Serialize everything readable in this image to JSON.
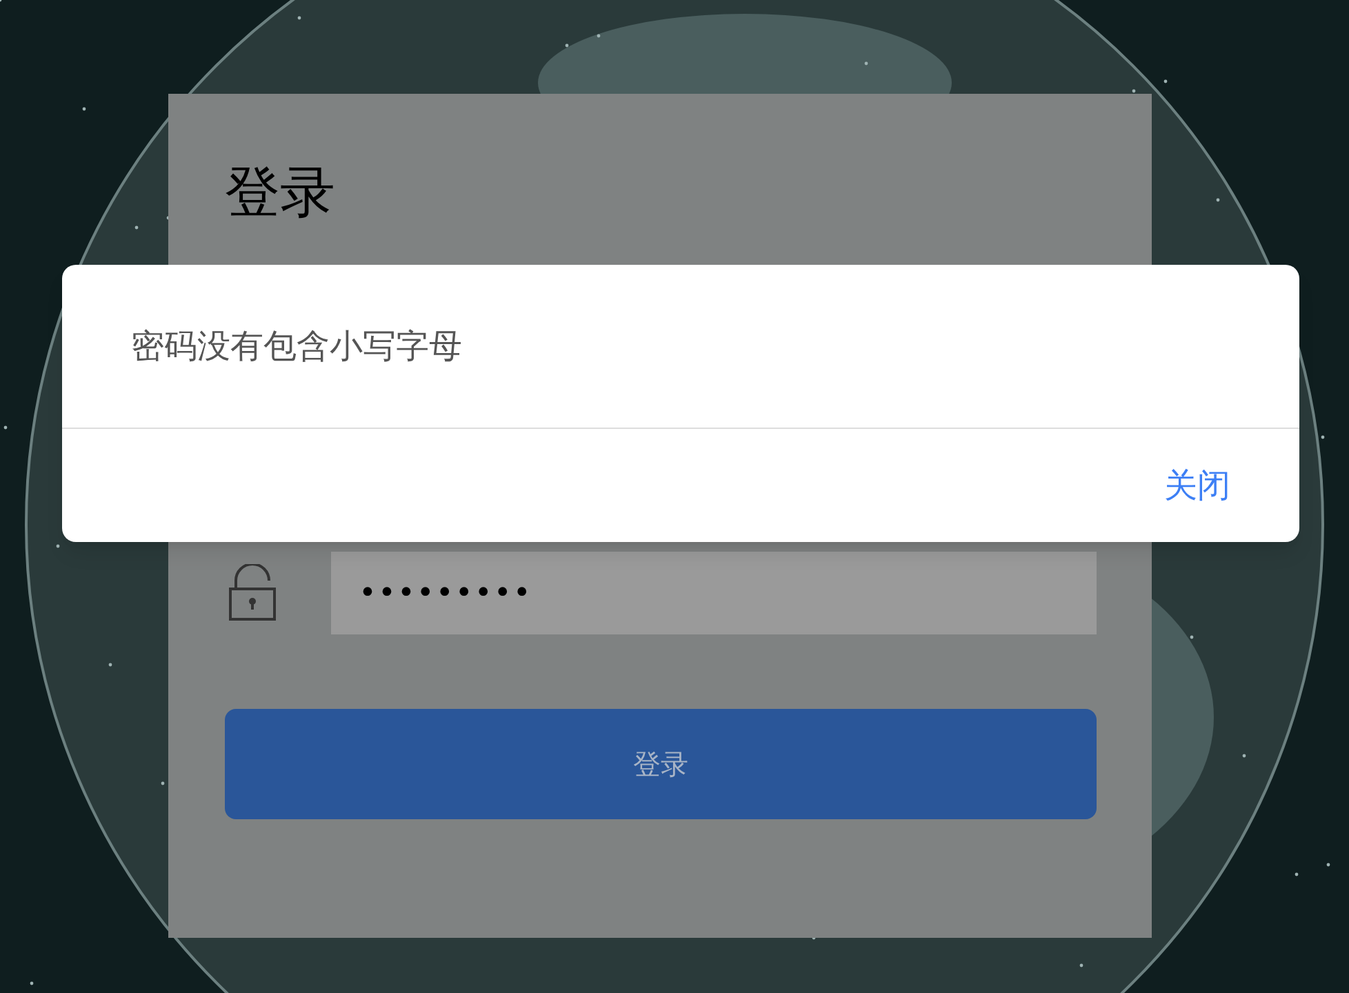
{
  "login_card": {
    "title": "登录",
    "password_value": "•••••••••",
    "submit_button": "登录"
  },
  "dialog": {
    "message": "密码没有包含小写字母",
    "close_button": "关闭"
  }
}
